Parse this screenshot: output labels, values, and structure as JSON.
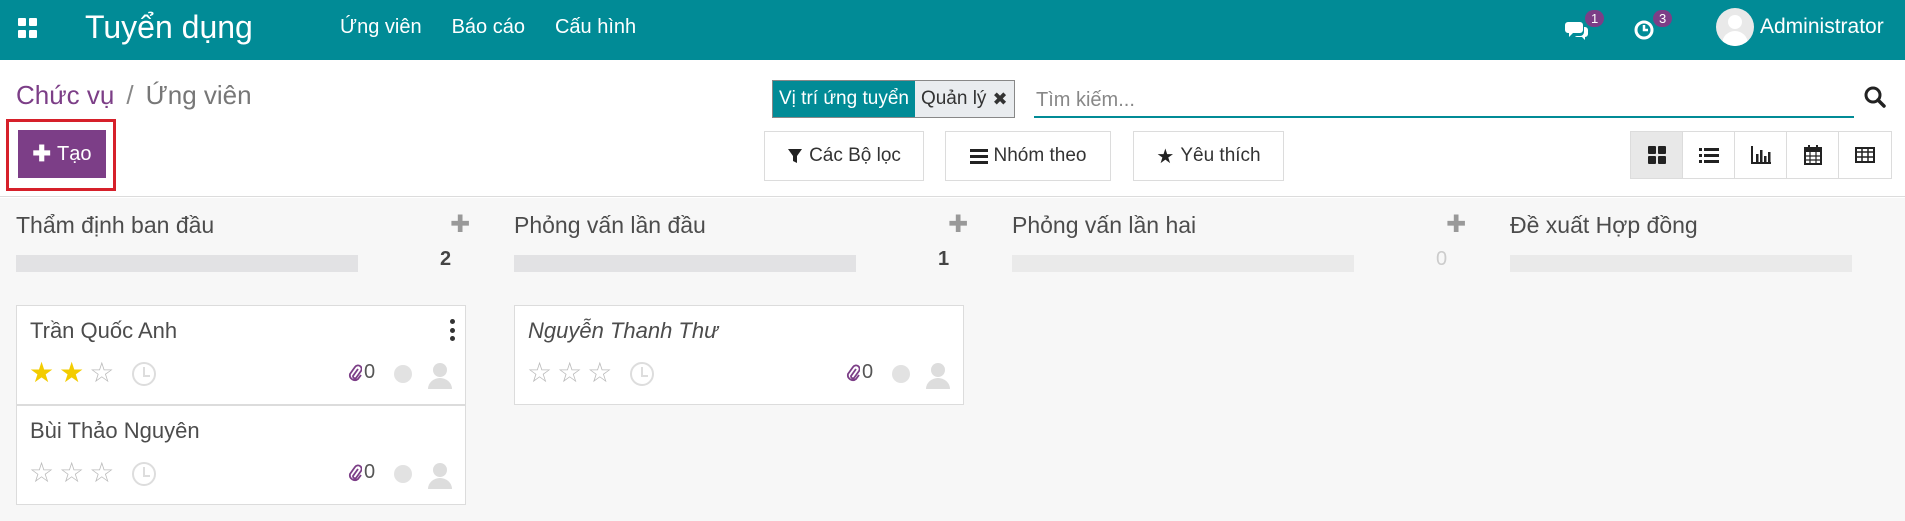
{
  "navbar": {
    "brand": "Tuyển dụng",
    "menu": [
      "Ứng viên",
      "Báo cáo",
      "Cấu hình"
    ],
    "messages_count": "1",
    "activities_count": "3",
    "user": "Administrator",
    "color": "#018b96"
  },
  "breadcrumb": {
    "parent": "Chức vụ",
    "separator": "/",
    "current": "Ứng viên"
  },
  "actions": {
    "create_label": "Tạo"
  },
  "search": {
    "facet_label": "Vị trí ứng tuyển",
    "facet_value": "Quản lý",
    "placeholder": "Tìm kiếm..."
  },
  "filters": {
    "filters_label": "Các Bộ lọc",
    "group_label": "Nhóm theo",
    "favorites_label": "Yêu thích"
  },
  "views": [
    "kanban",
    "list",
    "graph",
    "calendar",
    "pivot"
  ],
  "active_view": "kanban",
  "kanban": {
    "columns": [
      {
        "title": "Thẩm định ban đầu",
        "count": "2",
        "cards": [
          {
            "name": "Trần Quốc Anh",
            "stars": 2,
            "attachments": "0"
          },
          {
            "name": "Bùi Thảo Nguyên",
            "stars": 0,
            "attachments": "0"
          }
        ]
      },
      {
        "title": "Phỏng vấn lần đầu",
        "count": "1",
        "cards": [
          {
            "name": "Nguyễn Thanh Thư",
            "stars": 0,
            "attachments": "0"
          }
        ]
      },
      {
        "title": "Phỏng vấn lần hai",
        "count": "0",
        "cards": []
      },
      {
        "title": "Đề xuất Hợp đồng",
        "cards": []
      }
    ]
  }
}
